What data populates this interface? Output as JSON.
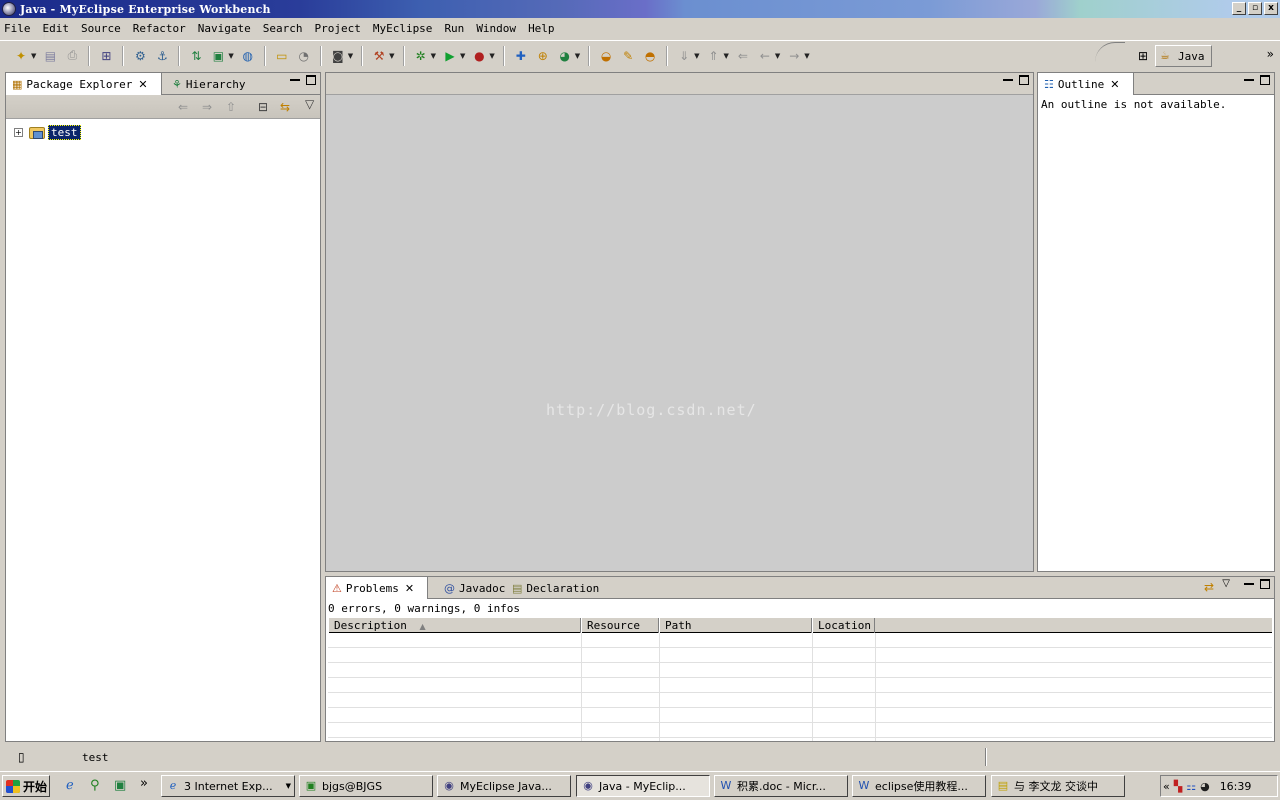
{
  "window": {
    "title": "Java - MyEclipse Enterprise Workbench",
    "min": "_",
    "max": "▫",
    "close": "x"
  },
  "menu": [
    "File",
    "Edit",
    "Source",
    "Refactor",
    "Navigate",
    "Search",
    "Project",
    "MyEclipse",
    "Run",
    "Window",
    "Help"
  ],
  "perspective": {
    "label": "Java",
    "more": "»"
  },
  "package_explorer": {
    "tabs": [
      {
        "label": "Package Explorer",
        "icon": "package-icon",
        "active": true
      },
      {
        "label": "Hierarchy",
        "icon": "hierarchy-icon",
        "active": false
      }
    ],
    "tree": [
      {
        "label": "test",
        "expander": "+"
      }
    ]
  },
  "outline": {
    "tab": "Outline",
    "message": "An outline is not available."
  },
  "editor": {
    "watermark": "http://blog.csdn.net/"
  },
  "bottom_panel": {
    "tabs": [
      {
        "label": "Problems",
        "icon": "warning-icon"
      },
      {
        "label": "Javadoc",
        "icon": "at-icon"
      },
      {
        "label": "Declaration",
        "icon": "declaration-icon"
      }
    ],
    "summary": "0 errors, 0 warnings, 0 infos",
    "columns": [
      "Description",
      "Resource",
      "Path",
      "Location"
    ]
  },
  "status": {
    "text": "test"
  },
  "taskbar": {
    "start": "开始",
    "tasks": [
      {
        "label": "3 Internet Exp...",
        "active": false
      },
      {
        "label": "bjgs@BJGS",
        "active": false
      },
      {
        "label": "MyEclipse Java...",
        "active": false
      },
      {
        "label": "Java - MyEclip...",
        "active": true
      },
      {
        "label": "积累.doc - Micr...",
        "active": false
      },
      {
        "label": "eclipse使用教程...",
        "active": false
      },
      {
        "label": "与 李文龙 交谈中",
        "active": false
      }
    ],
    "clock": "16:39"
  }
}
